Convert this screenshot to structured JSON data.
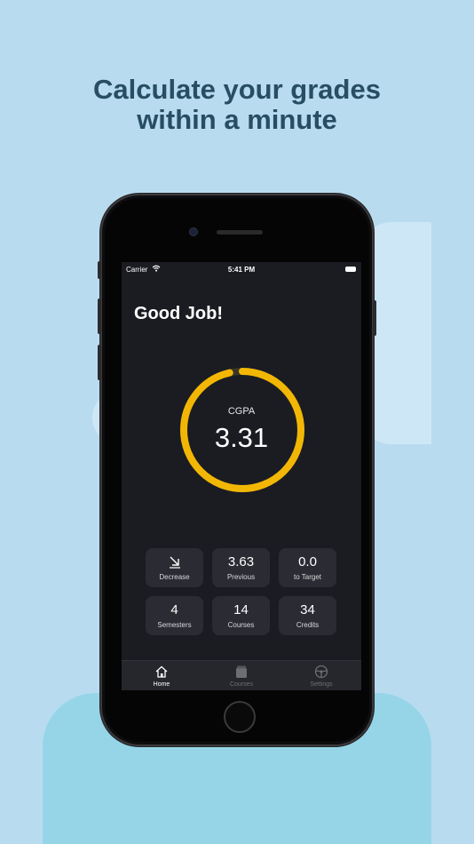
{
  "headline": {
    "line1": "Calculate your grades",
    "line2": "within a minute"
  },
  "status_bar": {
    "carrier": "Carrier",
    "time": "5:41 PM"
  },
  "greeting": "Good Job!",
  "cgpa": {
    "label": "CGPA",
    "value": "3.31",
    "progress": 0.965
  },
  "stats": [
    {
      "value": "",
      "label": "Decrease",
      "icon": "arrow-down-right-icon"
    },
    {
      "value": "3.63",
      "label": "Previous"
    },
    {
      "value": "0.0",
      "label": "to Target"
    },
    {
      "value": "4",
      "label": "Semesters"
    },
    {
      "value": "14",
      "label": "Courses"
    },
    {
      "value": "34",
      "label": "Credits"
    }
  ],
  "tabs": [
    {
      "label": "Home",
      "icon": "home-icon",
      "active": true
    },
    {
      "label": "Courses",
      "icon": "book-stack-icon",
      "active": false
    },
    {
      "label": "Settings",
      "icon": "steering-wheel-icon",
      "active": false
    }
  ],
  "colors": {
    "background": "#b9dbef",
    "headline": "#274e63",
    "screen": "#1b1c22",
    "ring_accent": "#f2b705",
    "ring_track": "#3a3528",
    "tile": "#2b2c33"
  }
}
